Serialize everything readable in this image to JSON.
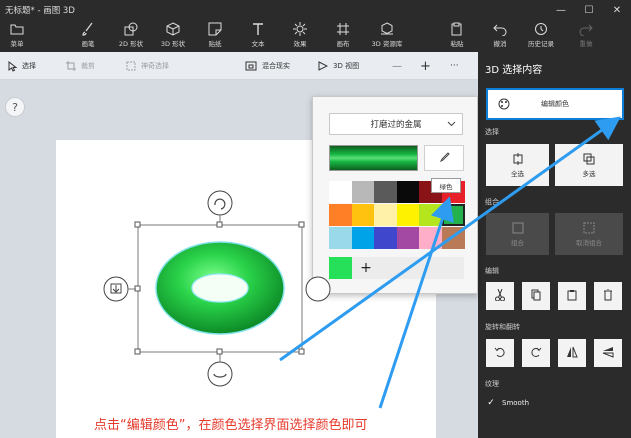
{
  "window": {
    "title": "无标题* - 画图 3D",
    "controls": [
      "—",
      "☐",
      "✕"
    ]
  },
  "ribbon": {
    "items": [
      {
        "label": "菜单",
        "icon": "folder-icon"
      },
      {
        "label": "画笔",
        "icon": "brush-icon"
      },
      {
        "label": "2D 形状",
        "icon": "2d-shapes-icon"
      },
      {
        "label": "3D 形状",
        "icon": "3d-shapes-icon"
      },
      {
        "label": "贴纸",
        "icon": "stickers-icon"
      },
      {
        "label": "文本",
        "icon": "text-icon"
      },
      {
        "label": "效果",
        "icon": "effects-icon"
      },
      {
        "label": "画布",
        "icon": "canvas-icon"
      },
      {
        "label": "3D 资源库",
        "icon": "3d-library-icon"
      },
      {
        "label": "粘贴",
        "icon": "paste-icon"
      },
      {
        "label": "撤消",
        "icon": "undo-icon"
      },
      {
        "label": "历史记录",
        "icon": "history-icon"
      },
      {
        "label": "重做",
        "icon": "redo-icon"
      }
    ]
  },
  "toolbar": {
    "select": "选择",
    "crop": "裁剪",
    "magic_select": "神奇选择",
    "mixed_reality": "混合现实",
    "view_3d": "3D 视图",
    "zoom_out": "—",
    "zoom_in": "+",
    "more": "···"
  },
  "help": {
    "label": "?"
  },
  "right_panel": {
    "title": "3D 选择内容",
    "edit_color": "编辑颜色",
    "section_select": "选择",
    "deselect": "全选",
    "multi_select": "多选",
    "section_group": "组合",
    "group": "组合",
    "ungroup": "取消组合",
    "section_edit": "编辑",
    "section_rotate": "旋转和翻转",
    "section_texture": "纹理",
    "smooth": "Smooth"
  },
  "popup": {
    "material": "打磨过的金属",
    "tooltip": "绿色",
    "selected_color": "#17b843",
    "palette": [
      [
        "#ffffff",
        "#b8b8b8",
        "#5a5a5a",
        "#0a0a0a",
        "#8a1318",
        "#e8202a"
      ],
      [
        "#ff7f27",
        "#ffc20e",
        "#fff2a8",
        "#fff200",
        "#b5e61d",
        "#22b14c"
      ],
      [
        "#99d9ea",
        "#00a2e8",
        "#3f48cc",
        "#a349a4",
        "#ffaec9",
        "#b97a57"
      ]
    ],
    "custom_color": "#26e05a",
    "add": "+"
  },
  "annotation": {
    "text": "点击“编辑颜色”，在颜色选择界面选择颜色即可",
    "color": "#e53a2b",
    "arrow_color": "#2e9cf0"
  },
  "object": {
    "shape": "torus",
    "color": "#2ad34a"
  }
}
